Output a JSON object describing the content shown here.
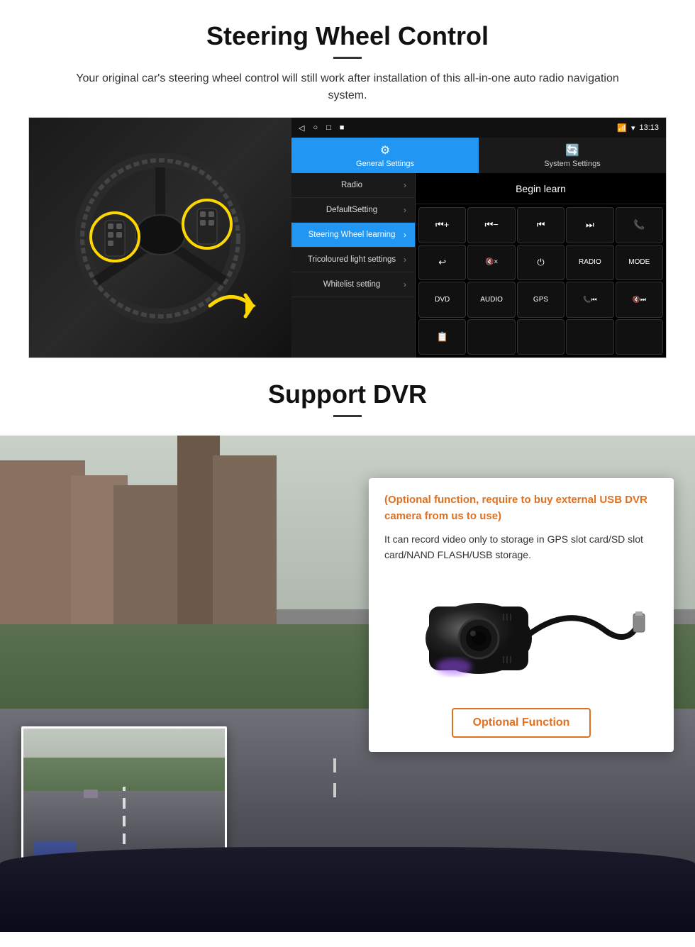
{
  "page": {
    "section1": {
      "title": "Steering Wheel Control",
      "subtitle": "Your original car's steering wheel control will still work after installation of this all-in-one auto radio navigation system.",
      "android": {
        "statusbar": {
          "nav_icons": [
            "◁",
            "○",
            "□",
            "■"
          ],
          "time": "13:13",
          "signal_icon": "▾",
          "wifi_icon": "▾"
        },
        "tabs": [
          {
            "label": "General Settings",
            "icon": "⚙",
            "active": true
          },
          {
            "label": "System Settings",
            "icon": "🔄",
            "active": false
          }
        ],
        "menu_items": [
          {
            "label": "Radio",
            "active": false
          },
          {
            "label": "DefaultSetting",
            "active": false
          },
          {
            "label": "Steering Wheel learning",
            "active": true
          },
          {
            "label": "Tricoloured light settings",
            "active": false
          },
          {
            "label": "Whitelist setting",
            "active": false
          }
        ],
        "begin_learn": "Begin learn",
        "control_buttons": [
          "⏮+",
          "⏮-",
          "⏮",
          "⏭",
          "📞",
          "↩",
          "🔇x",
          "⏻",
          "RADIO",
          "MODE",
          "DVD",
          "AUDIO",
          "GPS",
          "📞⏮",
          "🔇⏭",
          "📋",
          "",
          "",
          "",
          ""
        ]
      }
    },
    "section2": {
      "title": "Support DVR",
      "divider": "—",
      "card": {
        "orange_text": "(Optional function, require to buy external USB DVR camera from us to use)",
        "description": "It can record video only to storage in GPS slot card/SD slot card/NAND FLASH/USB storage.",
        "optional_button": "Optional Function"
      }
    }
  }
}
